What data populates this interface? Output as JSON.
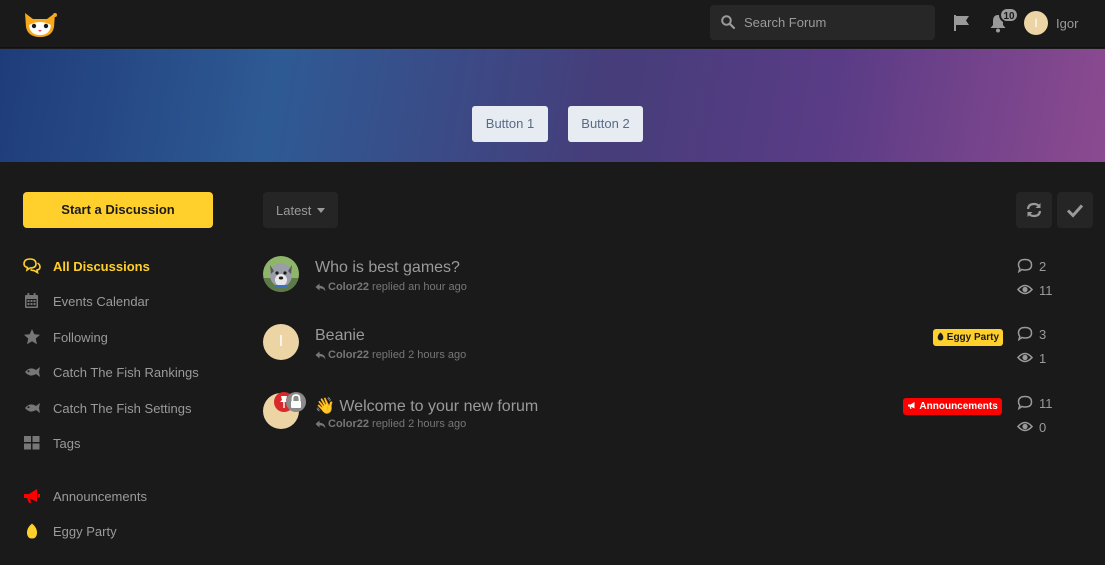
{
  "header": {
    "search_placeholder": "Search Forum",
    "notification_count": "10",
    "user_initial": "I",
    "user_name": "Igor"
  },
  "hero": {
    "button1": "Button 1",
    "button2": "Button 2"
  },
  "sidebar": {
    "start_button": "Start a Discussion",
    "items": [
      {
        "label": "All Discussions",
        "icon": "comments-icon"
      },
      {
        "label": "Events Calendar",
        "icon": "calendar-icon"
      },
      {
        "label": "Following",
        "icon": "star-icon"
      },
      {
        "label": "Catch The Fish Rankings",
        "icon": "fish-icon"
      },
      {
        "label": "Catch The Fish Settings",
        "icon": "fish-icon"
      },
      {
        "label": "Tags",
        "icon": "tags-grid-icon"
      },
      {
        "label": "Announcements",
        "icon": "megaphone-icon"
      },
      {
        "label": "Eggy Party",
        "icon": "egg-icon"
      }
    ]
  },
  "toolbar": {
    "sort_label": "Latest"
  },
  "discussions": [
    {
      "title": "Who is best games?",
      "author": "Color22",
      "action": "replied",
      "time": "an hour ago",
      "tag": "",
      "replies": "2",
      "views": "11"
    },
    {
      "title": "Beanie",
      "avatar_initial": "I",
      "author": "Color22",
      "action": "replied",
      "time": "2 hours ago",
      "tag": "Eggy Party",
      "tag_color": "#ffd02b",
      "replies": "3",
      "views": "1"
    },
    {
      "title": "👋 Welcome to your new forum",
      "author": "Color22",
      "action": "replied",
      "time": "2 hours ago",
      "tag": "Announcements",
      "tag_color": "#ff0000",
      "replies": "11",
      "views": "0"
    }
  ],
  "colors": {
    "accent": "#ffd02b",
    "background": "#1a1a1b",
    "announcement": "#ff0000"
  }
}
